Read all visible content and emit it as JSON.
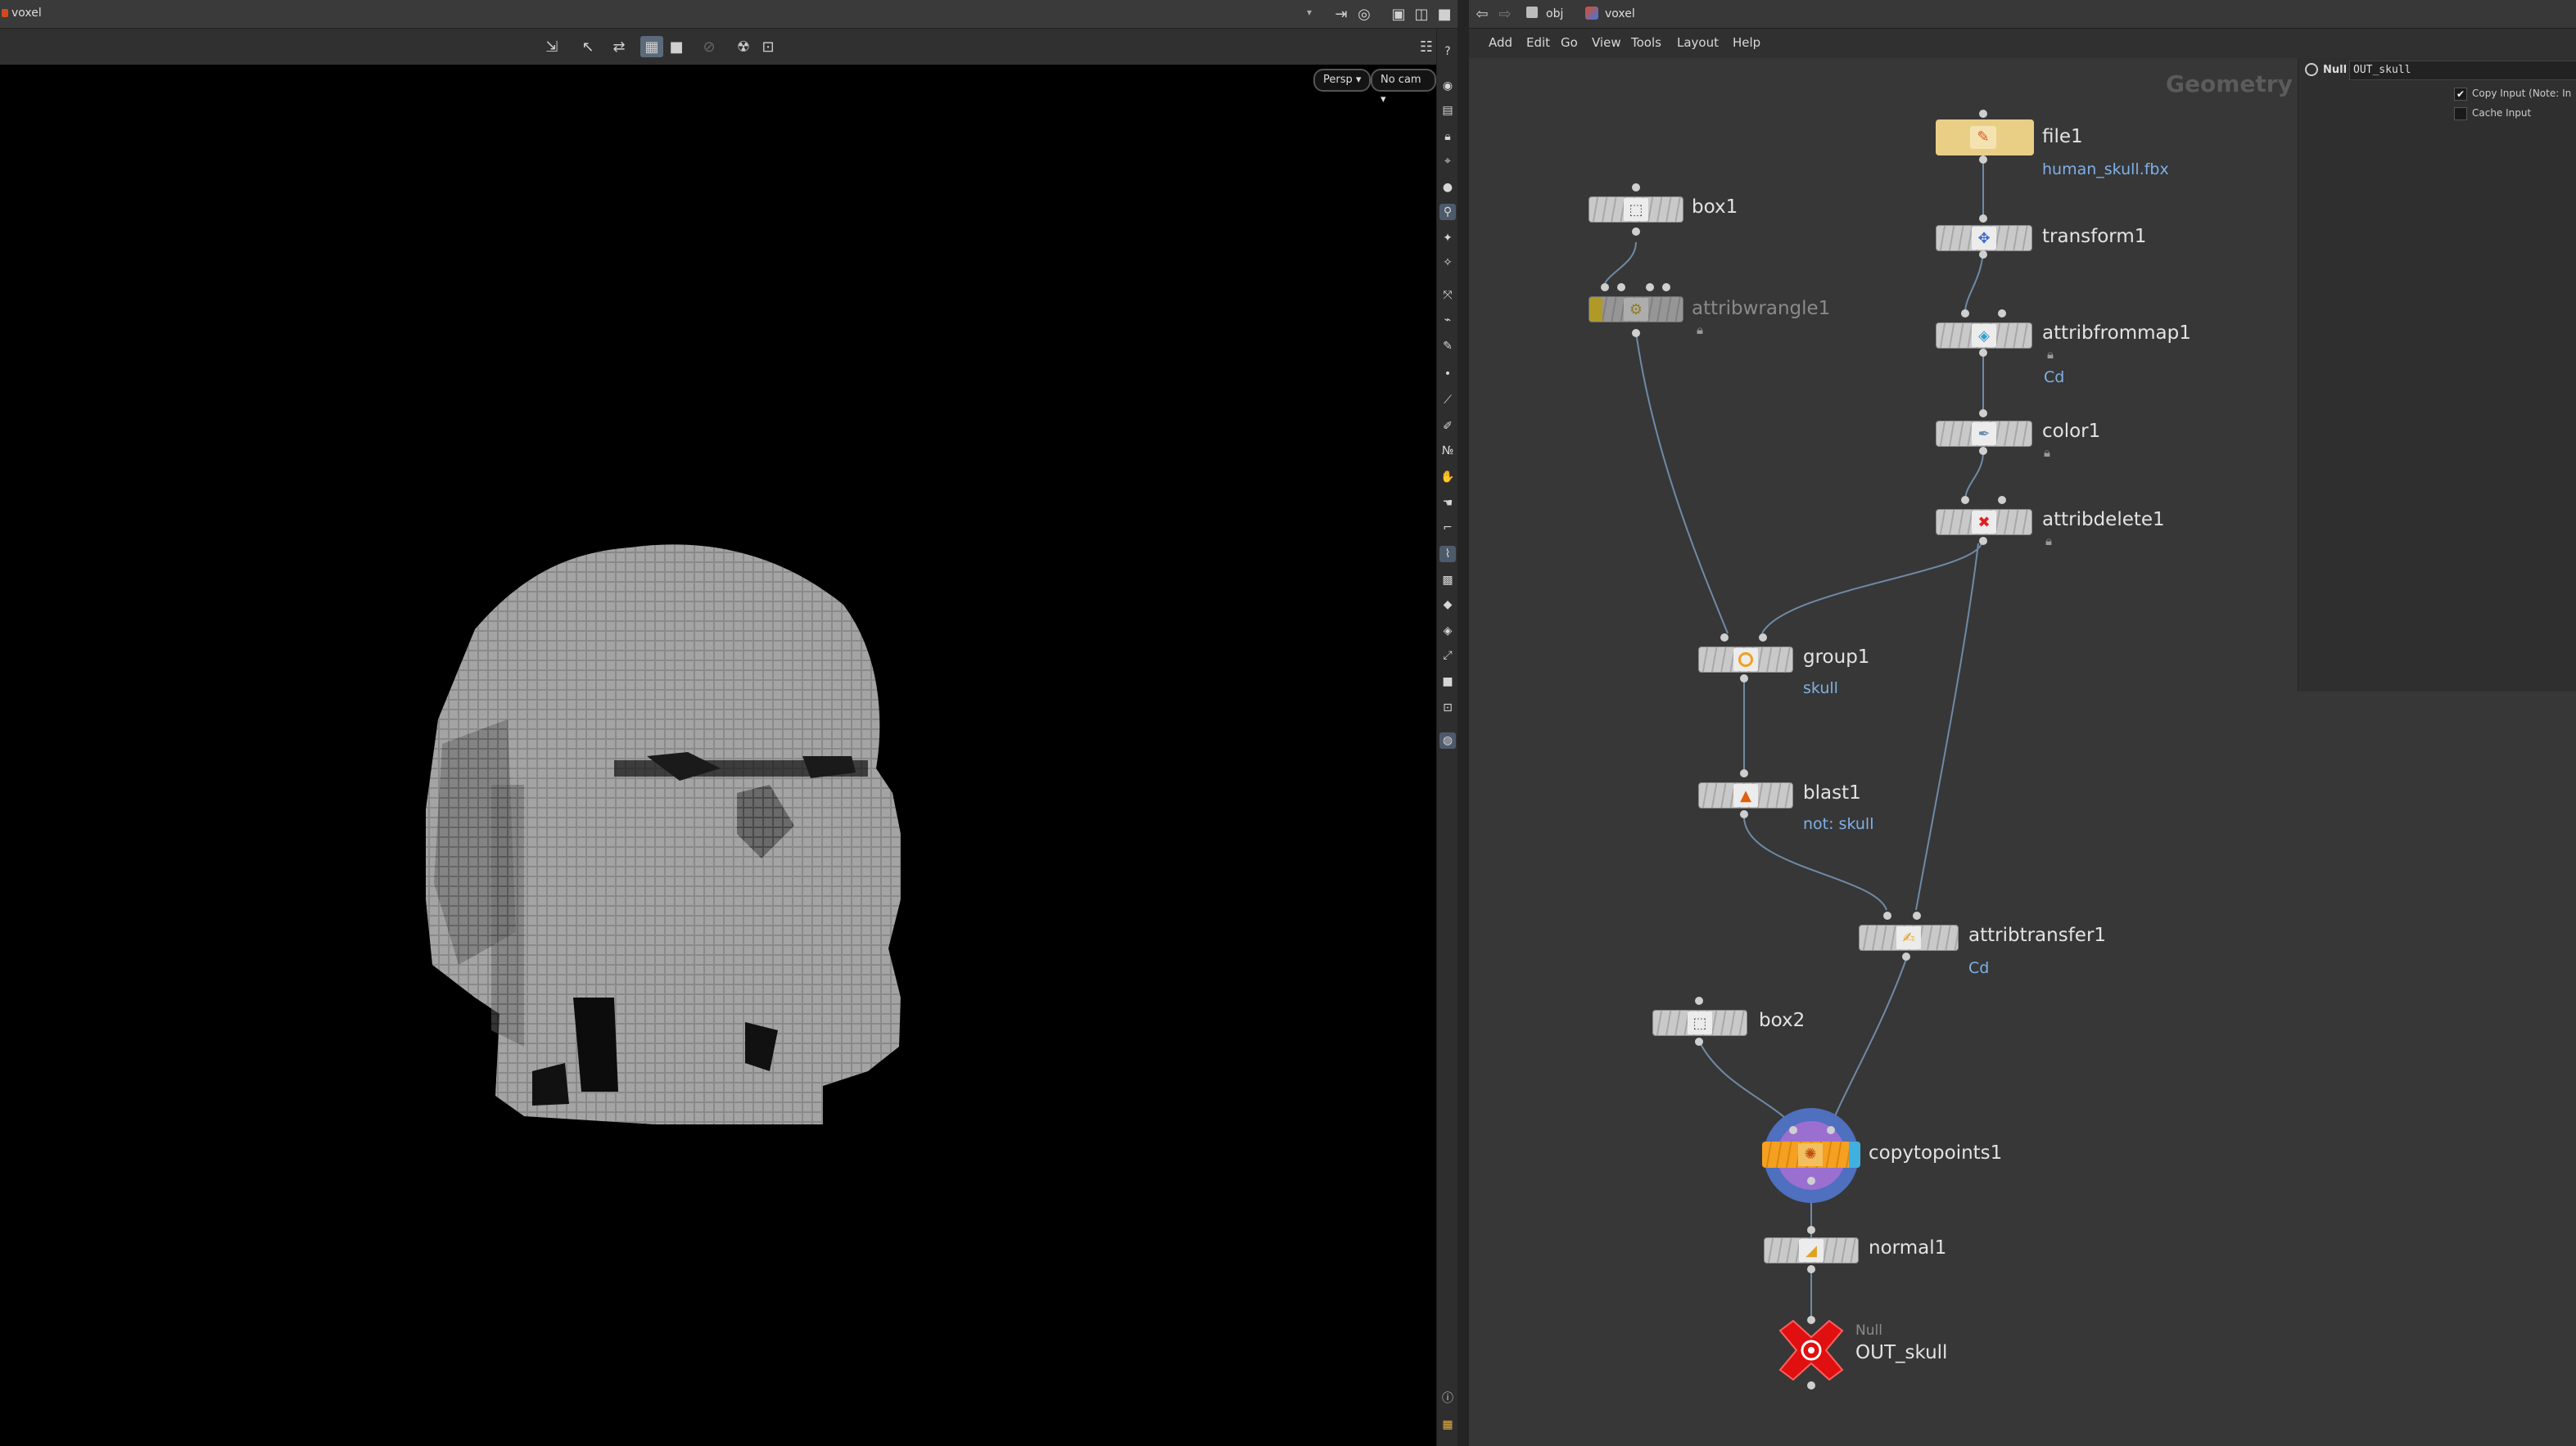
{
  "viewport_pane": {
    "title": "voxel",
    "camera_mode": "Persp ▾",
    "camera": "No cam ▾"
  },
  "network_pane": {
    "path": [
      "obj",
      "voxel"
    ],
    "menu": [
      "Add",
      "Edit",
      "Go",
      "View",
      "Tools",
      "Layout",
      "Help"
    ],
    "context_label": "Geometry"
  },
  "parameters": {
    "node_type": "Null",
    "node_name": "OUT_skull",
    "copy_input_label": "Copy Input (Note: In",
    "copy_input_checked": true,
    "cache_input_label": "Cache Input",
    "cache_input_checked": false
  },
  "nodes": {
    "file1": {
      "name": "file1",
      "sub": "human_skull.fbx"
    },
    "box1": {
      "name": "box1"
    },
    "transform1": {
      "name": "transform1"
    },
    "attribwrangle1": {
      "name": "attribwrangle1"
    },
    "attribfrommap1": {
      "name": "attribfrommap1",
      "sub": "Cd"
    },
    "color1": {
      "name": "color1"
    },
    "attribdelete1": {
      "name": "attribdelete1"
    },
    "group1": {
      "name": "group1",
      "sub": "skull"
    },
    "blast1": {
      "name": "blast1",
      "sub": "not: skull"
    },
    "attribtransfer1": {
      "name": "attribtransfer1",
      "sub": "Cd"
    },
    "box2": {
      "name": "box2"
    },
    "copytopoints1": {
      "name": "copytopoints1"
    },
    "normal1": {
      "name": "normal1"
    },
    "OUT_skull": {
      "name": "OUT_skull",
      "type": "Null"
    }
  },
  "colors": {
    "file_node": "#e9cf86",
    "wrangle_flag": "#f0d020",
    "display_flag_blue": "#4f6fbf",
    "render_flag_purple": "#9a6fd0",
    "template_orange": "#f5a020",
    "null_red": "#e01010",
    "subtext_blue": "#7fb0e6"
  },
  "icons": {
    "viewport_toolbar": [
      "select-icon",
      "move-icon",
      "rotate-icon",
      "scale-icon",
      "wireframe-icon",
      "shaded-icon",
      "ghost-icon",
      "light-icon",
      "camera-icon"
    ],
    "shelf": [
      "eye-icon",
      "display-icon",
      "lock-icon",
      "snap-icon",
      "sphere-icon",
      "light-bulb-icon",
      "handle-icon"
    ]
  }
}
